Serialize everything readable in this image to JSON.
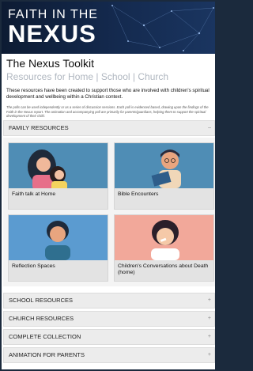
{
  "hero": {
    "line1": "FAITH IN THE",
    "line2": "NEXUS"
  },
  "page_title": "The Nexus Toolkit",
  "nav": [
    "Resources for Home",
    "School",
    "Church"
  ],
  "nav_separator": "|",
  "intro": "These resources have been created to support those who are involved with children's spiritual development and wellbeing within a Christian context.",
  "note": "The polls can be used independently or as a series of discussion sessions. Each poll is evidenced based, drawing upon the findings of the Faith in the Nexus report. The animation and accompanying poll are primarily for parents/guardians, helping them to support the spiritual development of their child.",
  "sections": {
    "family": "FAMILY RESOURCES",
    "school": "SCHOOL RESOURCES",
    "church": "CHURCH RESOURCES",
    "complete": "COMPLETE COLLECTION",
    "animation": "ANIMATION FOR PARENTS"
  },
  "cards": [
    {
      "label": "Faith talk at Home",
      "image": "mother-and-child-illustration"
    },
    {
      "label": "Bible Encounters",
      "image": "child-reading-bible-illustration"
    },
    {
      "label": "Reflection Spaces",
      "image": "child-reflecting-illustration"
    },
    {
      "label": "Children's Conversations about Death (home)",
      "image": "child-with-bandage-illustration"
    }
  ],
  "colors": {
    "hero_bg": "#0d1b33",
    "card_blue": "#4f8db5",
    "card_peach": "#f2a89a",
    "nav_text": "#b0b7c0"
  }
}
